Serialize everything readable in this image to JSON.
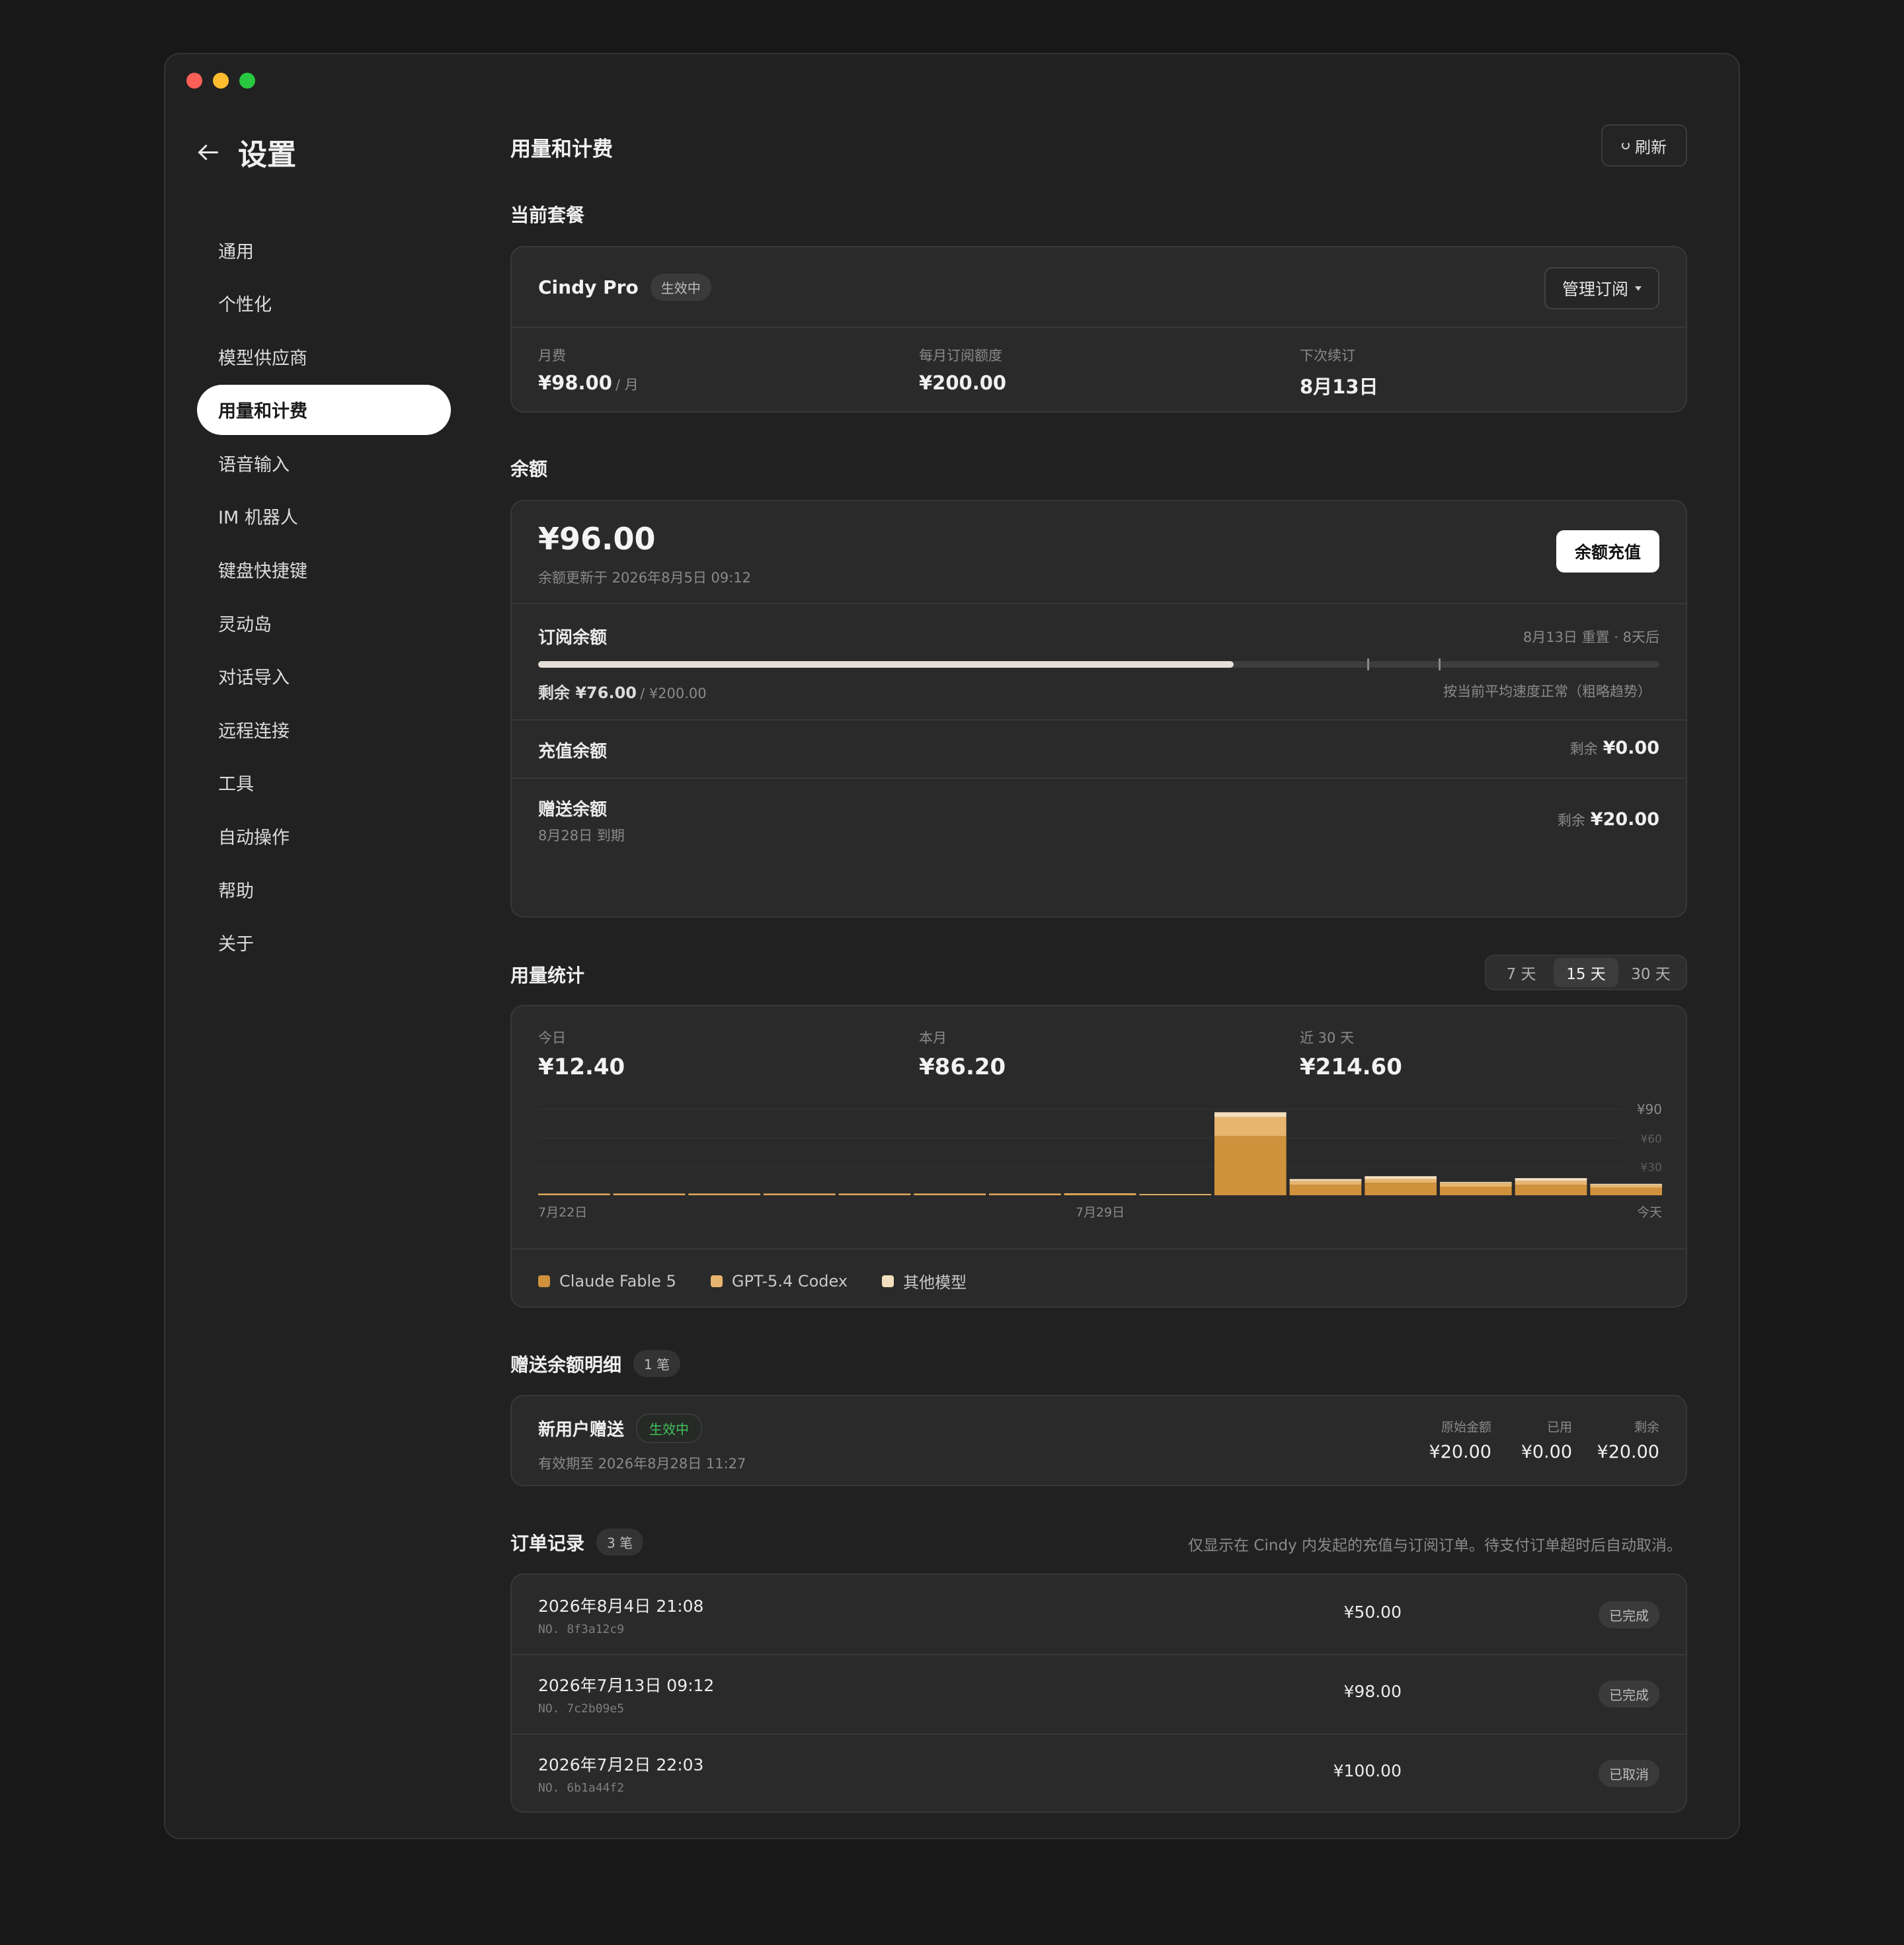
{
  "sidebar": {
    "title": "设置",
    "items": [
      {
        "label": "通用"
      },
      {
        "label": "个性化"
      },
      {
        "label": "模型供应商"
      },
      {
        "label": "用量和计费"
      },
      {
        "label": "语音输入"
      },
      {
        "label": "IM 机器人"
      },
      {
        "label": "键盘快捷键"
      },
      {
        "label": "灵动岛"
      },
      {
        "label": "对话导入"
      },
      {
        "label": "远程连接"
      },
      {
        "label": "工具"
      },
      {
        "label": "自动操作"
      },
      {
        "label": "帮助"
      },
      {
        "label": "关于"
      }
    ],
    "active_item": "用量和计费"
  },
  "page": {
    "title": "用量和计费",
    "refresh_label": "刷新"
  },
  "plan": {
    "section_title": "当前套餐",
    "name": "Cindy Pro",
    "status": "生效中",
    "manage_label": "管理订阅",
    "monthly_fee_label": "月费",
    "monthly_fee": "¥98.00",
    "monthly_fee_unit": "/ 月",
    "quota_label": "每月订阅额度",
    "quota": "¥200.00",
    "renewal_label": "下次续订",
    "renewal": "8月13日"
  },
  "balance": {
    "section_title": "余额",
    "total": "¥96.00",
    "updated": "余额更新于 2026年8月5日 09:12",
    "topup_label": "余额充值",
    "subscription": {
      "label": "订阅余额",
      "reset_note": "8月13日 重置 · 8天后",
      "remaining_label": "剩余 ¥76.00",
      "total_label": "/ ¥200.00",
      "trend_note": "按当前平均速度正常（粗略趋势）",
      "remaining_fraction": 0.62
    },
    "topup": {
      "label": "充值余额",
      "remaining_prefix": "剩余",
      "remaining": "¥0.00"
    },
    "gift": {
      "label": "赠送余额",
      "expiry": "8月28日 到期",
      "remaining_prefix": "剩余",
      "remaining": "¥20.00"
    }
  },
  "usage": {
    "section_title": "用量统计",
    "ranges": [
      "7 天",
      "15 天",
      "30 天"
    ],
    "active_range": "15 天",
    "today_label": "今日",
    "today": "¥12.40",
    "month_label": "本月",
    "month": "¥86.20",
    "last30_label": "近 30 天",
    "last30": "¥214.60"
  },
  "chart_data": {
    "type": "bar",
    "stacked": true,
    "categories": [
      "7月22日",
      "",
      "",
      "",
      "",
      "",
      "",
      "7月29日",
      "",
      "",
      "",
      "",
      "",
      "",
      "今天"
    ],
    "x_tick_labels": [
      "7月22日",
      "7月29日",
      "今天"
    ],
    "y_tick_labels": [
      "¥90",
      "¥60",
      "¥30"
    ],
    "ylim": [
      0,
      90
    ],
    "series": [
      {
        "name": "Claude Fable 5",
        "color": "#cf913c",
        "values": [
          1.5,
          1.5,
          1.5,
          1.5,
          1.5,
          1.5,
          1.5,
          1.8,
          1.2,
          62,
          11,
          13,
          9,
          11,
          8
        ]
      },
      {
        "name": "GPT-5.4 Codex",
        "color": "#e7b56e",
        "values": [
          0.3,
          0.3,
          0.3,
          0.3,
          0.3,
          0.3,
          0.3,
          0.3,
          0.2,
          20,
          4,
          4,
          4,
          4,
          3
        ]
      },
      {
        "name": "其他模型",
        "color": "#f3dfbd",
        "values": [
          0,
          0,
          0,
          0,
          0,
          0,
          0,
          0,
          0,
          5,
          2,
          3,
          1,
          3,
          1
        ]
      }
    ],
    "legend_position": "bottom-left",
    "grid": true
  },
  "gift_detail": {
    "section_title": "赠送余额明细",
    "count": "1 笔",
    "name": "新用户赠送",
    "status": "生效中",
    "validity": "有效期至 2026年8月28日 11:27",
    "original_label": "原始金额",
    "original": "¥20.00",
    "used_label": "已用",
    "used": "¥0.00",
    "remaining_label": "剩余",
    "remaining": "¥20.00"
  },
  "orders": {
    "section_title": "订单记录",
    "count": "3 笔",
    "note": "仅显示在 Cindy 内发起的充值与订阅订单。待支付订单超时后自动取消。",
    "rows": [
      {
        "date": "2026年8月4日 21:08",
        "no": "NO. 8f3a12c9",
        "amount": "¥50.00",
        "status": "已完成"
      },
      {
        "date": "2026年7月13日 09:12",
        "no": "NO. 7c2b09e5",
        "amount": "¥98.00",
        "status": "已完成"
      },
      {
        "date": "2026年7月2日 22:03",
        "no": "NO. 6b1a44f2",
        "amount": "¥100.00",
        "status": "已取消"
      }
    ]
  }
}
